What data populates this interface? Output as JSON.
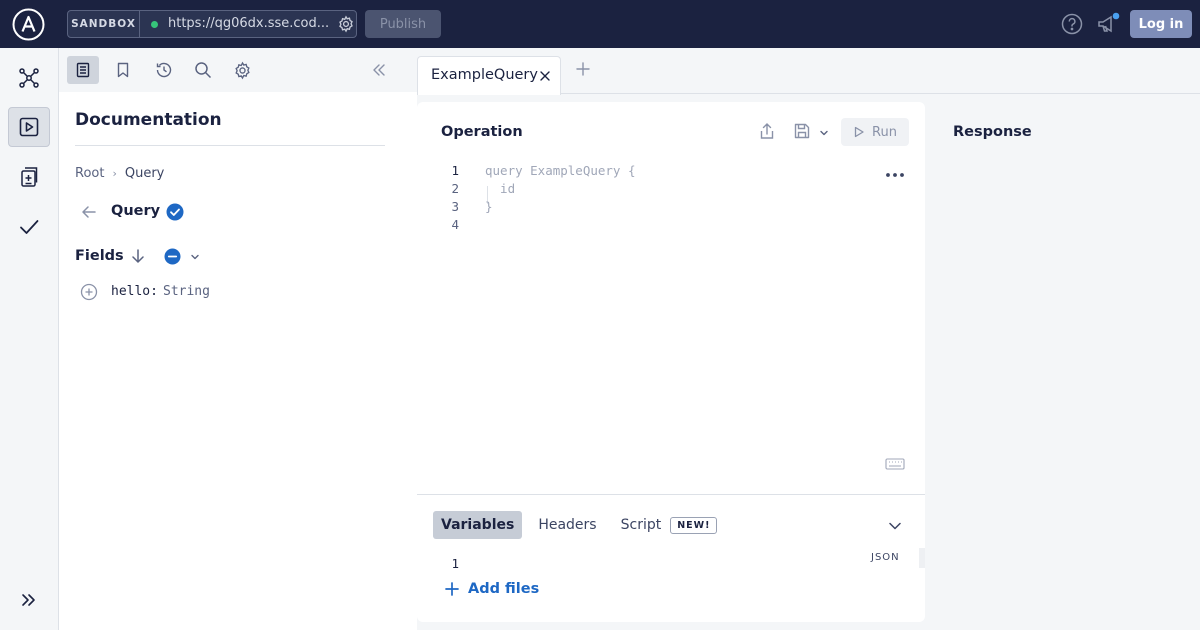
{
  "topbar": {
    "sandbox_label": "SANDBOX",
    "endpoint_url": "https://qg06dx.sse.cod...",
    "publish_label": "Publish",
    "login_label": "Log in",
    "colors": {
      "background": "#1b2240",
      "connected": "#36c47a",
      "login_bg": "#7e8db8"
    }
  },
  "rail": {
    "items": [
      {
        "icon": "schema-graph-icon"
      },
      {
        "icon": "sandbox-play-icon",
        "active": true
      },
      {
        "icon": "diff-icon"
      },
      {
        "icon": "checks-icon"
      }
    ],
    "expand_icon": "expand-chevrons-icon"
  },
  "docs": {
    "toolbar_icons": [
      "document-icon",
      "bookmark-icon",
      "history-icon",
      "search-icon",
      "settings-icon",
      "collapse-chevrons-icon"
    ],
    "title": "Documentation",
    "breadcrumb": {
      "root": "Root",
      "current": "Query"
    },
    "type_name": "Query",
    "fields_label": "Fields",
    "fields": [
      {
        "name": "hello:",
        "type": "String"
      }
    ]
  },
  "tabs": [
    {
      "label": "ExampleQuery",
      "active": true
    }
  ],
  "operation": {
    "title": "Operation",
    "run_label": "Run",
    "code_lines": [
      {
        "num": "1",
        "text": "query ExampleQuery {"
      },
      {
        "num": "2",
        "text": "  id"
      },
      {
        "num": "3",
        "text": "}"
      },
      {
        "num": "4",
        "text": ""
      }
    ],
    "bottom_tabs": {
      "variables": "Variables",
      "headers": "Headers",
      "script": "Script",
      "new_badge": "NEW!"
    },
    "json_label": "JSON",
    "variables_line": "1",
    "add_files_label": "Add files"
  },
  "response": {
    "title": "Response"
  },
  "colors": {
    "accent": "#1e68c4",
    "panel": "#ffffff",
    "canvas": "#f4f6f8"
  }
}
